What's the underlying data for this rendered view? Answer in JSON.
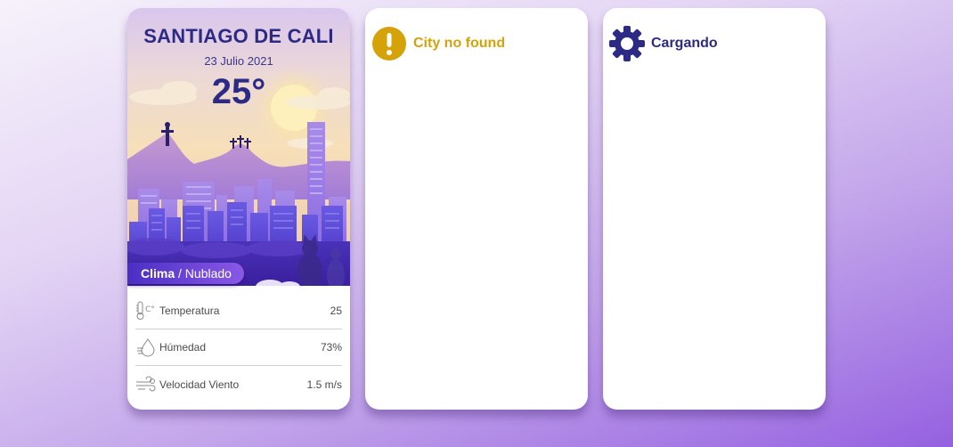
{
  "weather_card": {
    "city": "SANTIAGO DE CALI",
    "date": "23 Julio 2021",
    "temperature": "25°",
    "condition_label": "Clima",
    "condition_separator": " / ",
    "condition_value": "Nublado",
    "details": [
      {
        "icon": "thermometer-icon",
        "label": "Temperatura",
        "value": "25"
      },
      {
        "icon": "humidity-drop-icon",
        "label": "Húmedad",
        "value": "73%"
      },
      {
        "icon": "wind-icon",
        "label": "Velocidad Viento",
        "value": "1.5 m/s"
      }
    ],
    "hero_image": "city-skyline-illustration"
  },
  "error_card": {
    "icon": "exclamation-circle-icon",
    "message": "City no found",
    "color": "#d6a20a"
  },
  "loading_card": {
    "icon": "gear-icon",
    "message": "Cargando",
    "color": "#2d2a86"
  },
  "colors": {
    "primary": "#2d2a86",
    "warning": "#d6a20a",
    "pill_start": "#4a2fc4",
    "pill_end": "#8a58e6"
  }
}
